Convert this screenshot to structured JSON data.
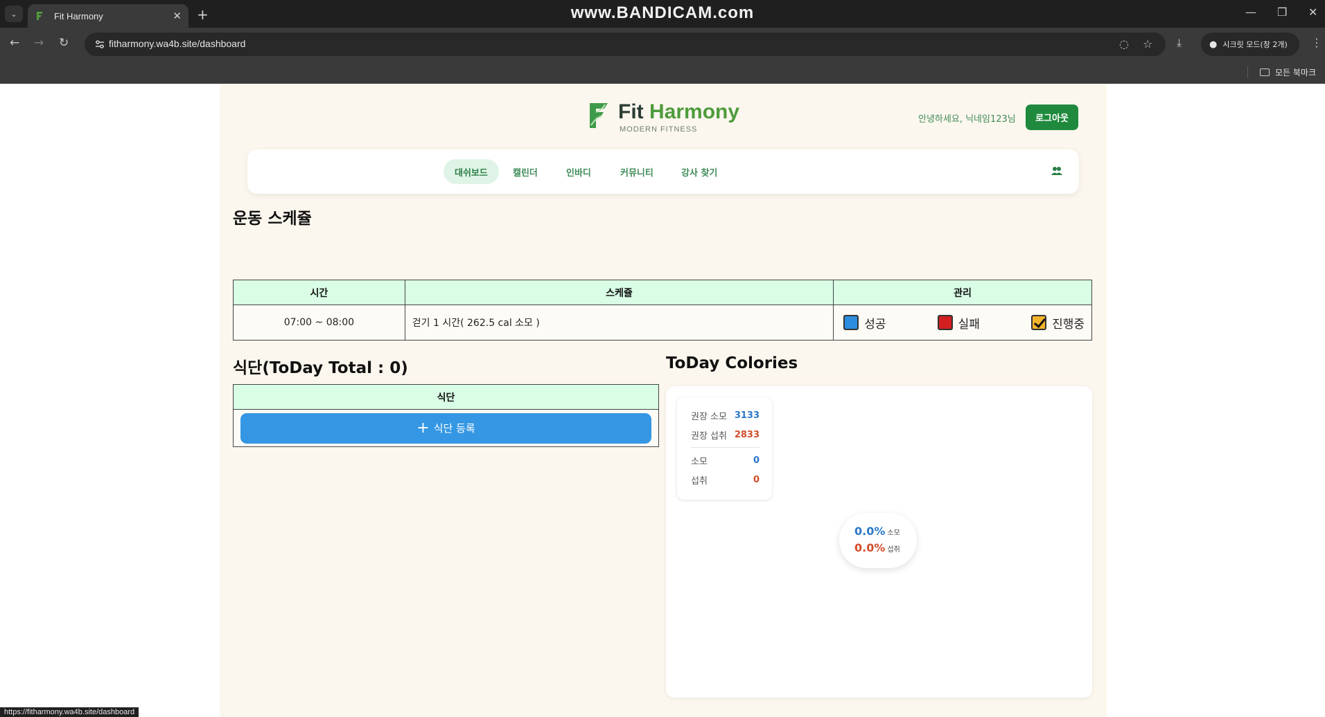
{
  "browser": {
    "tab_title": "Fit Harmony",
    "url": "fitharmony.wa4b.site/dashboard",
    "watermark": "www.BANDICAM.com",
    "incognito_label": "시크릿 모드(창 2개)",
    "bookmarks_label": "모든 북마크",
    "status_url": "https://fitharmony.wa4b.site/dashboard"
  },
  "brand": {
    "fit": "Fit",
    "harmony": "Harmony",
    "tagline": "MODERN FITNESS"
  },
  "header": {
    "greeting": "안녕하세요, 닉네임123님",
    "logout_label": "로그아웃"
  },
  "nav": {
    "items": [
      "대쉬보드",
      "캘린더",
      "인바디",
      "커뮤니티",
      "강사 찾기"
    ],
    "active_index": 0
  },
  "schedule": {
    "title": "운동 스케쥴",
    "headers": [
      "시간",
      "스케쥴",
      "관리"
    ],
    "rows": [
      {
        "time": "07:00 ~ 08:00",
        "schedule": "걷기 1 시간( 262.5 cal 소모 )"
      }
    ],
    "status_options": [
      "성공",
      "실패",
      "진행중"
    ]
  },
  "meal": {
    "title": "식단(ToDay Total : 0)",
    "header": "식단",
    "add_label": "식단 등록"
  },
  "calories": {
    "title": "ToDay Colories",
    "rec_burn_label": "권장 소모",
    "rec_burn_value": "3133",
    "rec_intake_label": "권장 섭취",
    "rec_intake_value": "2833",
    "burn_label": "소모",
    "burn_value": "0",
    "intake_label": "섭취",
    "intake_value": "0",
    "burn_pct": "0.0%",
    "burn_pct_label": "소모",
    "intake_pct": "0.0%",
    "intake_pct_label": "섭취"
  },
  "colors": {
    "brand_green": "#1f8a3e",
    "table_header": "#d9fde5",
    "button_blue": "#3597e3",
    "page_bg": "#fcf7ee"
  }
}
